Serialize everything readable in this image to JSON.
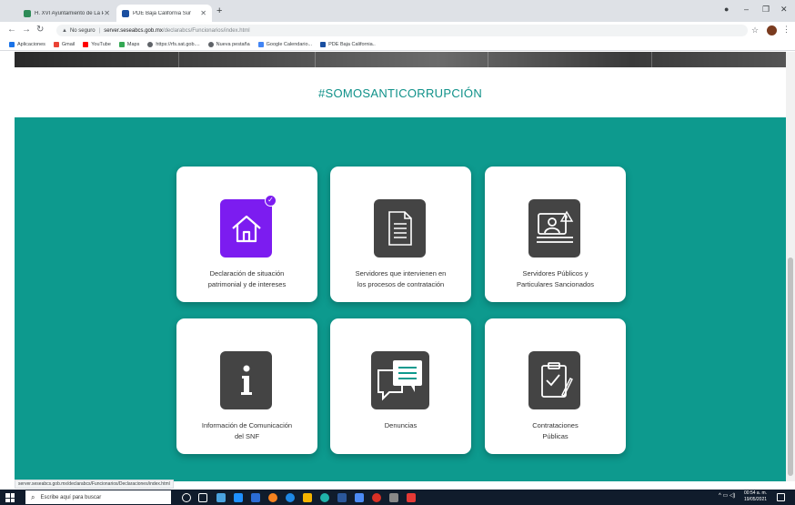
{
  "browser": {
    "tabs": [
      {
        "title": "H. XVI Ayuntamiento de La Paz",
        "active": false
      },
      {
        "title": "PDE Baja California Sur",
        "active": true
      }
    ],
    "new_tab": "+",
    "address": {
      "security_label": "No seguro",
      "host": "server.seseabcs.gob.mx",
      "path": "/declarabcs/Funcionarios/index.html"
    },
    "bookmarks": [
      {
        "label": "Aplicaciones",
        "color": "#1a73e8"
      },
      {
        "label": "Gmail",
        "color": "#ea4335"
      },
      {
        "label": "YouTube",
        "color": "#ff0000"
      },
      {
        "label": "Maps",
        "color": "#34a853"
      },
      {
        "label": "https://rfs.sat.gob....",
        "color": "#5f6368"
      },
      {
        "label": "Nueva pestaña",
        "color": "#5f6368"
      },
      {
        "label": "Google Calendario...",
        "color": "#4285f4"
      },
      {
        "label": "PDE Baja California..",
        "color": "#1a4fa0"
      }
    ],
    "status_url": "server.seseabcs.gob.mx/declarabcs/Funcionarios/Declaraciones/index.html"
  },
  "page": {
    "slogan": "#SOMOSANTICORRUPCIÓN",
    "accent_color": "#0d9a8e",
    "cards": [
      {
        "label": "Declaración de situación\npatrimonial y de intereses",
        "icon": "house-icon",
        "highlight": true
      },
      {
        "label": "Servidores que intervienen en\nlos procesos de contratación",
        "icon": "document-icon",
        "highlight": false
      },
      {
        "label": "Servidores Públicos y\nParticulares Sancionados",
        "icon": "sanctioned-person-icon",
        "highlight": false
      },
      {
        "label": "Información de Comunicación\ndel SNF",
        "icon": "info-icon",
        "highlight": false
      },
      {
        "label": "Denuncias",
        "icon": "chat-bubbles-icon",
        "highlight": false
      },
      {
        "label": "Contrataciones\nPúblicas",
        "icon": "clipboard-check-icon",
        "highlight": false
      }
    ]
  },
  "taskbar": {
    "search_placeholder": "Escribe aquí para buscar",
    "time": "00:54 a. m.",
    "date": "19/05/2021"
  }
}
